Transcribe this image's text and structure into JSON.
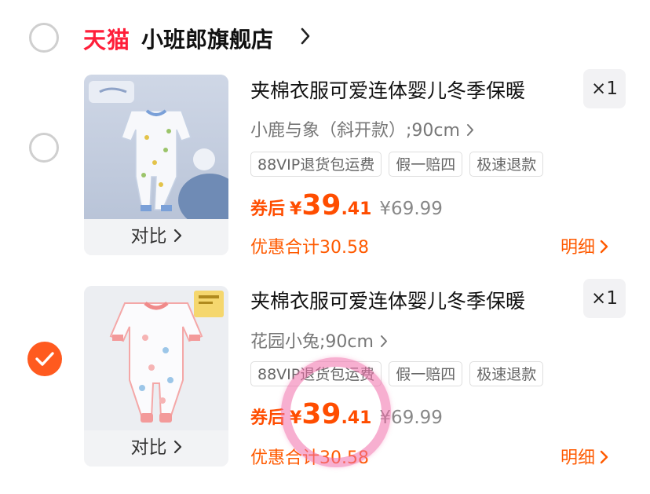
{
  "store": {
    "logo_text": "天猫",
    "name": "小班郎旗舰店"
  },
  "items": [
    {
      "title": "夹棉衣服可爱连体婴儿冬季保暖",
      "quantity": "×1",
      "spec": "小鹿与象（斜开款）;90cm",
      "tags": [
        "88VIP退货包运费",
        "假一赔四",
        "极速退款"
      ],
      "price_label": "券后",
      "currency": "¥",
      "price_int": "39",
      "price_dec": ".41",
      "original_price": "¥69.99",
      "discount_text": "优惠合计30.58",
      "detail_label": "明细",
      "compare_label": "对比",
      "selected": false
    },
    {
      "title": "夹棉衣服可爱连体婴儿冬季保暖",
      "quantity": "×1",
      "spec": "花园小兔;90cm",
      "tags": [
        "88VIP退货包运费",
        "假一赔四",
        "极速退款"
      ],
      "price_label": "券后",
      "currency": "¥",
      "price_int": "39",
      "price_dec": ".41",
      "original_price": "¥69.99",
      "discount_text": "优惠合计30.58",
      "detail_label": "明细",
      "compare_label": "对比",
      "selected": true
    }
  ],
  "colors": {
    "accent": "#ff5a1f",
    "price": "#ff4d00",
    "tmall_red": "#ff1f3a",
    "annotation_circle": "#f06eaa"
  }
}
